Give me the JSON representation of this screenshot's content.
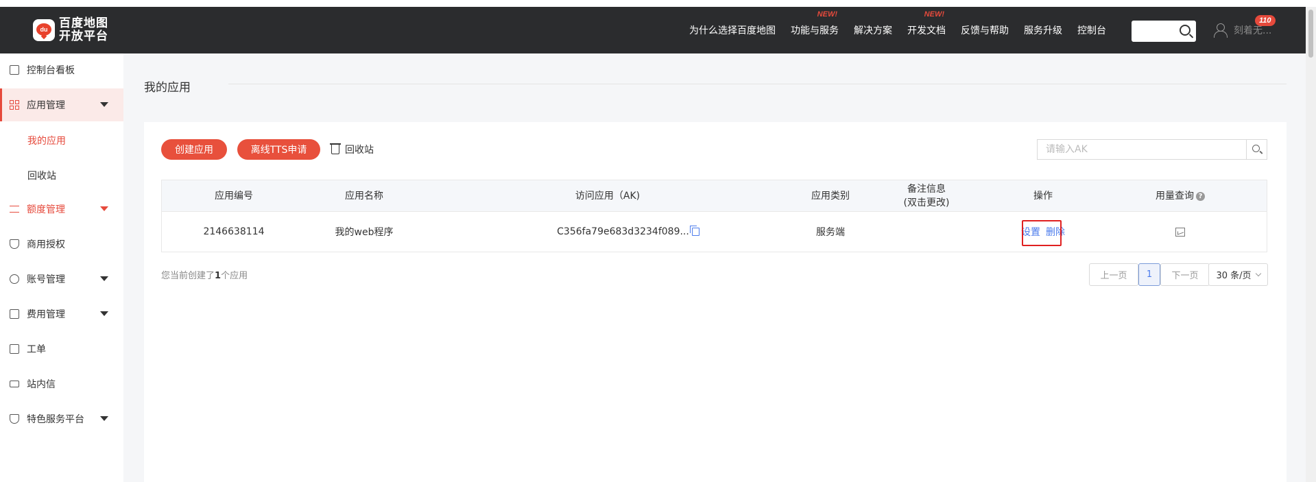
{
  "header": {
    "logo_line1": "百度地图",
    "logo_line2": "开放平台",
    "logo_mark": "du",
    "nav": [
      {
        "label": "为什么选择百度地图",
        "new": ""
      },
      {
        "label": "功能与服务",
        "new": "NEW!"
      },
      {
        "label": "解决方案",
        "new": ""
      },
      {
        "label": "开发文档",
        "new": "NEW!"
      },
      {
        "label": "反馈与帮助",
        "new": ""
      },
      {
        "label": "服务升级",
        "new": ""
      },
      {
        "label": "控制台",
        "new": ""
      }
    ],
    "user_name": "刻着无...",
    "badge_count": "110"
  },
  "sidebar": {
    "items": [
      {
        "label": "控制台看板",
        "icon": "dashboard-icon"
      },
      {
        "label": "应用管理",
        "icon": "grid-icon"
      },
      {
        "label": "额度管理",
        "icon": "sliders-icon"
      },
      {
        "label": "商用授权",
        "icon": "shield-icon"
      },
      {
        "label": "账号管理",
        "icon": "user-circle-icon"
      },
      {
        "label": "费用管理",
        "icon": "bill-icon"
      },
      {
        "label": "工单",
        "icon": "clipboard-icon"
      },
      {
        "label": "站内信",
        "icon": "mail-icon"
      },
      {
        "label": "特色服务平台",
        "icon": "shield-heart-icon"
      }
    ],
    "sub_items": [
      "我的应用",
      "回收站"
    ]
  },
  "main": {
    "title": "我的应用",
    "create_button": "创建应用",
    "tts_button": "离线TTS申请",
    "recycle_label": "回收站",
    "ak_placeholder": "请输入AK",
    "table": {
      "headers": [
        "应用编号",
        "应用名称",
        "访问应用（AK)",
        "应用类别",
        "备注信息\n(双击更改)",
        "操作",
        "用量查询"
      ],
      "header_remark_line1": "备注信息",
      "header_remark_line2": "(双击更改)",
      "rows": [
        {
          "id": "2146638114",
          "name": "我的web程序",
          "ak": "C356fa79e683d3234f089...",
          "type": "服务端",
          "remark": "",
          "action_set": "设置",
          "action_delete": "删除"
        }
      ]
    },
    "footnote_prefix": "您当前创建了",
    "footnote_count": "1",
    "footnote_suffix": "个应用",
    "pager": {
      "prev": "上一页",
      "current": "1",
      "next": "下一页",
      "size": "30 条/页"
    }
  },
  "colors": {
    "accent": "#e8503c",
    "header_bg": "#2b2c2e",
    "link": "#4b7bec",
    "highlight_box": "#e02020"
  }
}
